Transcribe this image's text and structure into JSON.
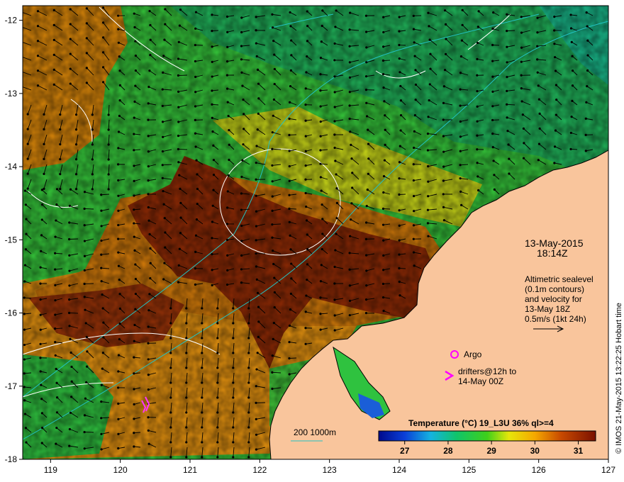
{
  "map": {
    "lon_ticks": [
      "119",
      "120",
      "121",
      "122",
      "123",
      "124",
      "125",
      "126",
      "127"
    ],
    "lat_ticks": [
      "-12",
      "-13",
      "-14",
      "-15",
      "-16",
      "-17",
      "-18"
    ],
    "lon_range": [
      118.6,
      127.0
    ],
    "lat_range": [
      -18.0,
      -11.8
    ]
  },
  "annotation": {
    "date": "13-May-2015",
    "time": "18:14Z",
    "altimetry_lines": [
      "Altimetric sealevel",
      "(0.1m contours)",
      "and velocity for",
      "13-May 18Z",
      "0.5m/s (1kt 24h)"
    ]
  },
  "legend": {
    "argo_label": "Argo",
    "drifters_lines": [
      "drifters@12h to",
      "14-May 00Z"
    ],
    "bathy_label": "200  1000m"
  },
  "colorbar": {
    "title": "Temperature  (°C) 19_L3U 36% ql>=4",
    "tick_labels": [
      "27",
      "28",
      "29",
      "30",
      "31"
    ],
    "range": [
      26.4,
      31.4
    ]
  },
  "credit": "© IMOS 21-May-2015 13:22:25 Hobart time",
  "colors": {
    "land": "#f9c59c",
    "warm": "#8b1a00",
    "mid": "#e88e00",
    "cool": "#22c455",
    "contour": "#ffffff",
    "bathy": "#22c3c3",
    "argo": "#ff00ff",
    "arrow": "#000000"
  },
  "chart_data": {
    "type": "heatmap",
    "title": "Temperature  (°C) 19_L3U 36% ql>=4",
    "xlabel": "",
    "ylabel": "",
    "xlim": [
      118.6,
      127.0
    ],
    "ylim": [
      -18.0,
      -11.8
    ],
    "value_range": [
      26.4,
      31.4
    ],
    "x_ticks": [
      119,
      120,
      121,
      122,
      123,
      124,
      125,
      126,
      127
    ],
    "y_ticks": [
      -12,
      -13,
      -14,
      -15,
      -16,
      -17,
      -18
    ],
    "colorbar_ticks": [
      27,
      28,
      29,
      30,
      31
    ]
  }
}
